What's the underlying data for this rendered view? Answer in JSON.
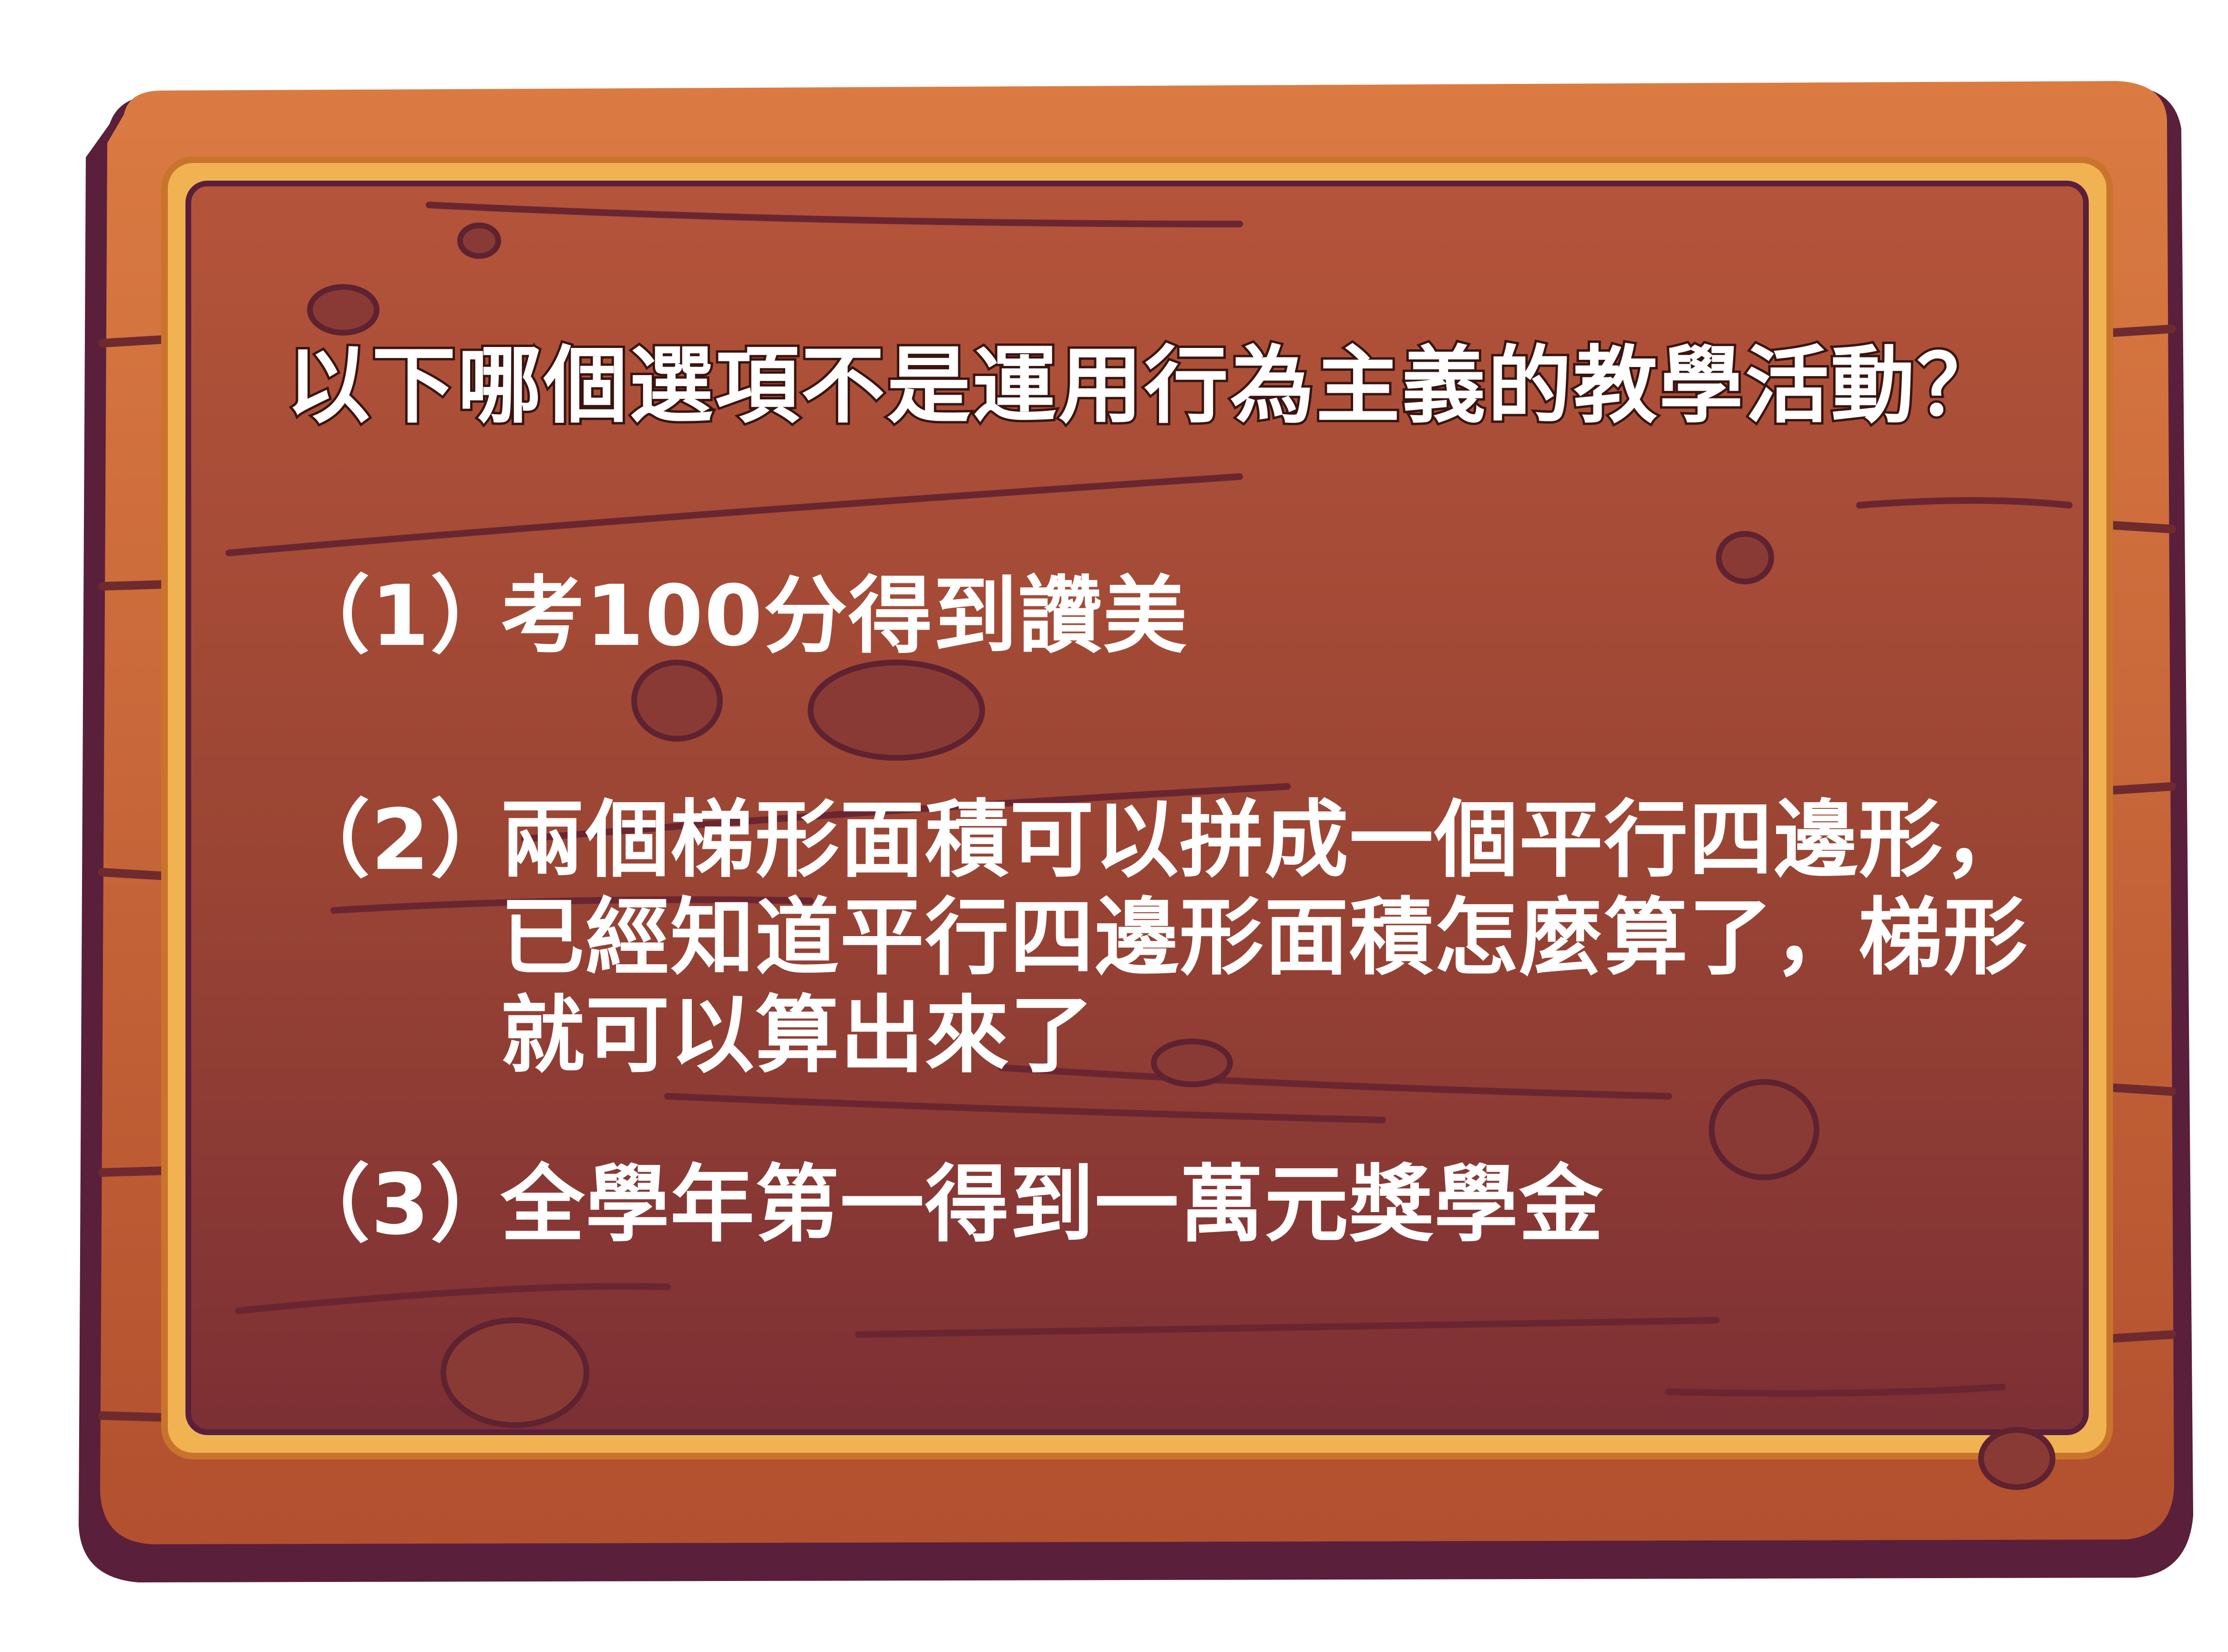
{
  "question": "以下哪個選項不是運用行為主義的教學活動？",
  "options": [
    {
      "number": "（1）",
      "text": "考100分得到讚美"
    },
    {
      "number": "（2）",
      "text": "兩個梯形面積可以拼成一個平行四邊形，已經知道平行四邊形面積怎麼算了，梯形就可以算出來了"
    },
    {
      "number": "（3）",
      "text": "全學年第一得到一萬元獎學金"
    }
  ],
  "colors": {
    "board": "#a24a36",
    "board_dark": "#6e2a2e",
    "frame_orange": "#cf6b39",
    "frame_shadow": "#5a1f3a",
    "gold_line": "#f4c15a",
    "text": "#ffffff"
  }
}
